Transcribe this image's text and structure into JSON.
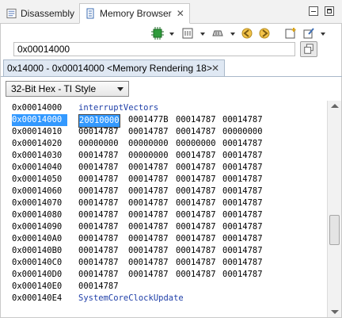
{
  "tabs": [
    {
      "label": "Disassembly",
      "icon": "disassembly-icon"
    },
    {
      "label": "Memory Browser",
      "icon": "memory-browser-icon"
    }
  ],
  "address_input": {
    "value": "0x00014000"
  },
  "rendering_tab": {
    "label": "0x14000 - 0x00014000 <Memory Rendering 18>"
  },
  "format_select": {
    "selected": "32-Bit Hex - TI Style"
  },
  "rows": [
    {
      "addr": "0x00014000",
      "label": "interruptVectors"
    },
    {
      "addr": "0x00014000",
      "words": [
        "20010000",
        "0001477B",
        "00014787",
        "00014787"
      ],
      "selected": true
    },
    {
      "addr": "0x00014010",
      "words": [
        "00014787",
        "00014787",
        "00014787",
        "00000000"
      ]
    },
    {
      "addr": "0x00014020",
      "words": [
        "00000000",
        "00000000",
        "00000000",
        "00014787"
      ]
    },
    {
      "addr": "0x00014030",
      "words": [
        "00014787",
        "00000000",
        "00014787",
        "00014787"
      ]
    },
    {
      "addr": "0x00014040",
      "words": [
        "00014787",
        "00014787",
        "00014787",
        "00014787"
      ]
    },
    {
      "addr": "0x00014050",
      "words": [
        "00014787",
        "00014787",
        "00014787",
        "00014787"
      ]
    },
    {
      "addr": "0x00014060",
      "words": [
        "00014787",
        "00014787",
        "00014787",
        "00014787"
      ]
    },
    {
      "addr": "0x00014070",
      "words": [
        "00014787",
        "00014787",
        "00014787",
        "00014787"
      ]
    },
    {
      "addr": "0x00014080",
      "words": [
        "00014787",
        "00014787",
        "00014787",
        "00014787"
      ]
    },
    {
      "addr": "0x00014090",
      "words": [
        "00014787",
        "00014787",
        "00014787",
        "00014787"
      ]
    },
    {
      "addr": "0x000140A0",
      "words": [
        "00014787",
        "00014787",
        "00014787",
        "00014787"
      ]
    },
    {
      "addr": "0x000140B0",
      "words": [
        "00014787",
        "00014787",
        "00014787",
        "00014787"
      ]
    },
    {
      "addr": "0x000140C0",
      "words": [
        "00014787",
        "00014787",
        "00014787",
        "00014787"
      ]
    },
    {
      "addr": "0x000140D0",
      "words": [
        "00014787",
        "00014787",
        "00014787",
        "00014787"
      ]
    },
    {
      "addr": "0x000140E0",
      "words": [
        "00014787"
      ]
    },
    {
      "addr": "0x000140E4",
      "label": "SystemCoreClockUpdate"
    }
  ],
  "colors": {
    "selection": "#3399ff",
    "label": "#1f3fa8",
    "tab_active_bg": "#ffffff",
    "rendering_tab_bg": "#dfe8f3"
  }
}
